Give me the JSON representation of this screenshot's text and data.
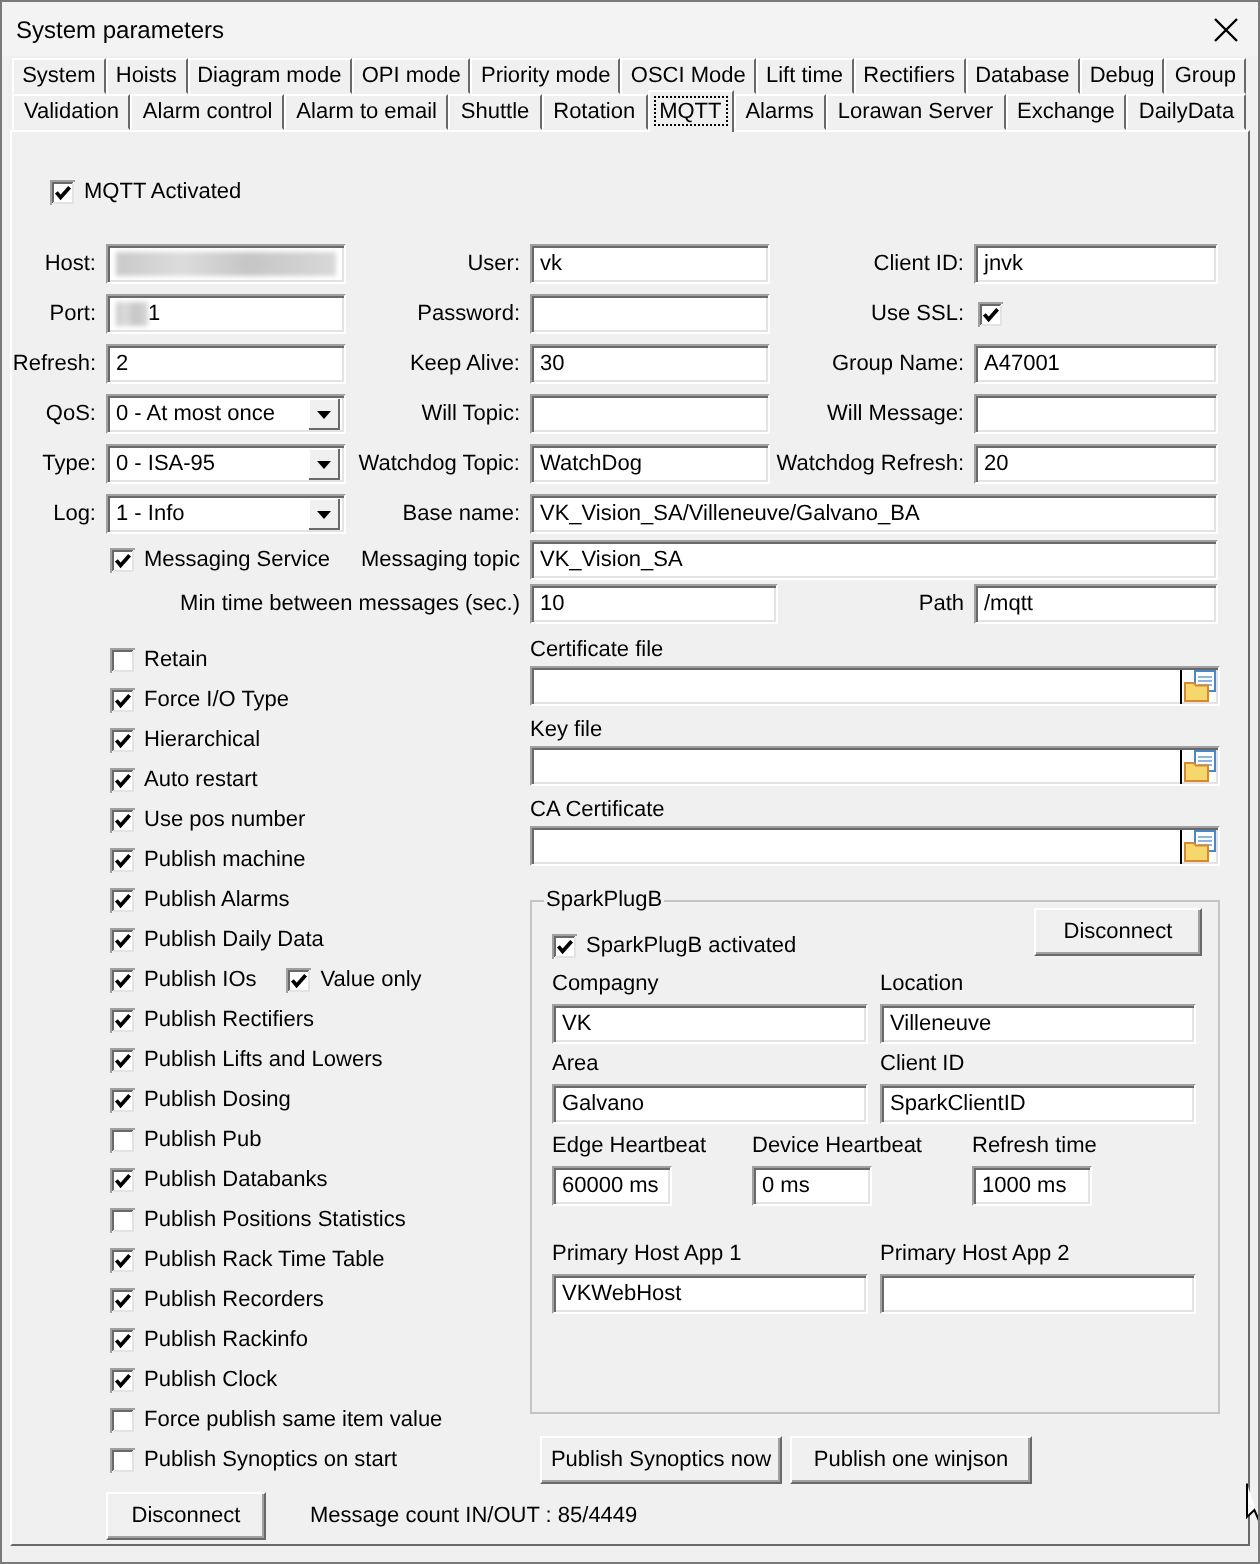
{
  "window": {
    "title": "System parameters"
  },
  "tab_rows": [
    {
      "tabs": [
        {
          "label": "System",
          "selected": false
        },
        {
          "label": "Hoists",
          "selected": false
        },
        {
          "label": "Diagram mode",
          "selected": false
        },
        {
          "label": "OPI mode",
          "selected": false
        },
        {
          "label": "Priority mode",
          "selected": false
        },
        {
          "label": "OSCI Mode",
          "selected": false
        },
        {
          "label": "Lift time",
          "selected": false
        },
        {
          "label": "Rectifiers",
          "selected": false
        },
        {
          "label": "Database",
          "selected": false
        },
        {
          "label": "Debug",
          "selected": false
        },
        {
          "label": "Group",
          "selected": false
        }
      ]
    },
    {
      "tabs": [
        {
          "label": "Validation",
          "selected": false
        },
        {
          "label": "Alarm control",
          "selected": false
        },
        {
          "label": "Alarm to email",
          "selected": false
        },
        {
          "label": "Shuttle",
          "selected": false
        },
        {
          "label": "Rotation",
          "selected": false
        },
        {
          "label": "MQTT",
          "selected": true
        },
        {
          "label": "Alarms",
          "selected": false
        },
        {
          "label": "Lorawan Server",
          "selected": false
        },
        {
          "label": "Exchange",
          "selected": false
        },
        {
          "label": "DailyData",
          "selected": false
        }
      ]
    }
  ],
  "mqtt_activated": {
    "label": "MQTT Activated",
    "checked": true
  },
  "form_rows": [
    {
      "items": [
        {
          "kind": "text",
          "label": "Host:",
          "redacted": true
        },
        {
          "kind": "text",
          "label": "User:",
          "value": "vk"
        },
        {
          "kind": "text",
          "label": "Client ID:",
          "value": "jnvk"
        }
      ]
    },
    {
      "items": [
        {
          "kind": "text",
          "label": "Port:",
          "value": "1",
          "redacted": true
        },
        {
          "kind": "text",
          "label": "Password:"
        },
        {
          "kind": "checkbox",
          "label": "Use SSL:",
          "checked": true
        }
      ]
    },
    {
      "items": [
        {
          "kind": "text",
          "label": "Refresh:",
          "value": "2"
        },
        {
          "kind": "text",
          "label": "Keep Alive:",
          "value": "30"
        },
        {
          "kind": "text",
          "label": "Group Name:",
          "value": "A47001"
        }
      ]
    },
    {
      "items": [
        {
          "kind": "select",
          "label": "QoS:",
          "value": "0 - At most once"
        },
        {
          "kind": "text",
          "label": "Will Topic:"
        },
        {
          "kind": "text",
          "label": "Will Message:"
        }
      ]
    },
    {
      "items": [
        {
          "kind": "select",
          "label": "Type:",
          "value": "0 - ISA-95"
        },
        {
          "kind": "text",
          "label": "Watchdog Topic:",
          "value": "WatchDog"
        },
        {
          "kind": "text",
          "label": "Watchdog Refresh:",
          "value": "20"
        }
      ]
    },
    {
      "items": [
        {
          "kind": "select",
          "label": "Log:",
          "value": "1 - Info"
        },
        {
          "kind": "text",
          "label": "Base name:",
          "value": "VK_Vision_SA/Villeneuve/Galvano_BA"
        }
      ]
    }
  ],
  "messaging_service": {
    "label": "Messaging Service",
    "checked": true
  },
  "messaging_topic": {
    "label": "Messaging topic",
    "value": "VK_Vision_SA"
  },
  "min_time": {
    "label": "Min time between messages (sec.)",
    "value": "10"
  },
  "path": {
    "label": "Path",
    "value": "/mqtt"
  },
  "options": [
    {
      "label": "Retain",
      "checked": false
    },
    {
      "label": "Force I/O Type",
      "checked": true
    },
    {
      "label": "Hierarchical",
      "checked": true
    },
    {
      "label": "Auto restart",
      "checked": true
    },
    {
      "label": "Use pos number",
      "checked": true
    },
    {
      "label": "Publish machine",
      "checked": true
    },
    {
      "label": "Publish Alarms",
      "checked": true
    },
    {
      "label": "Publish Daily Data",
      "checked": true
    },
    {
      "label": "Publish IOs",
      "checked": true,
      "sub_option": {
        "label": "Value only",
        "checked": true
      }
    },
    {
      "label": "Publish Rectifiers",
      "checked": true
    },
    {
      "label": "Publish Lifts and Lowers",
      "checked": true
    },
    {
      "label": "Publish Dosing",
      "checked": true
    },
    {
      "label": "Publish Pub",
      "checked": false
    },
    {
      "label": "Publish Databanks",
      "checked": true
    },
    {
      "label": "Publish Positions Statistics",
      "checked": false
    },
    {
      "label": "Publish Rack Time Table",
      "checked": true
    },
    {
      "label": "Publish Recorders",
      "checked": true
    },
    {
      "label": "Publish Rackinfo",
      "checked": true
    },
    {
      "label": "Publish Clock",
      "checked": true
    },
    {
      "label": "Force publish same item value",
      "checked": false
    },
    {
      "label": "Publish Synoptics on start",
      "checked": false
    }
  ],
  "files": [
    {
      "label": "Certificate file"
    },
    {
      "label": "Key file"
    },
    {
      "label": "CA Certificate"
    }
  ],
  "sparkplug": {
    "title": "SparkPlugB",
    "activated": {
      "label": "SparkPlugB activated",
      "checked": true
    },
    "button": "Disconnect",
    "fields": [
      {
        "label": "Compagny",
        "value": "VK"
      },
      {
        "label": "Location",
        "value": "Villeneuve"
      },
      {
        "label": "Area",
        "value": "Galvano"
      },
      {
        "label": "Client ID",
        "value": "SparkClientID"
      }
    ],
    "heartbeats": [
      {
        "label": "Edge Heartbeat",
        "value": "60000 ms"
      },
      {
        "label": "Device Heartbeat",
        "value": "0 ms"
      },
      {
        "label": "Refresh time",
        "value": "1000 ms"
      }
    ],
    "host_apps": [
      {
        "label": "Primary Host App 1",
        "value": "VKWebHost"
      },
      {
        "label": "Primary Host App 2"
      }
    ]
  },
  "publish_buttons": [
    "Publish Synoptics now",
    "Publish one winjson"
  ],
  "disconnect_button": "Disconnect",
  "message_count": "Message count IN/OUT : 85/4449"
}
